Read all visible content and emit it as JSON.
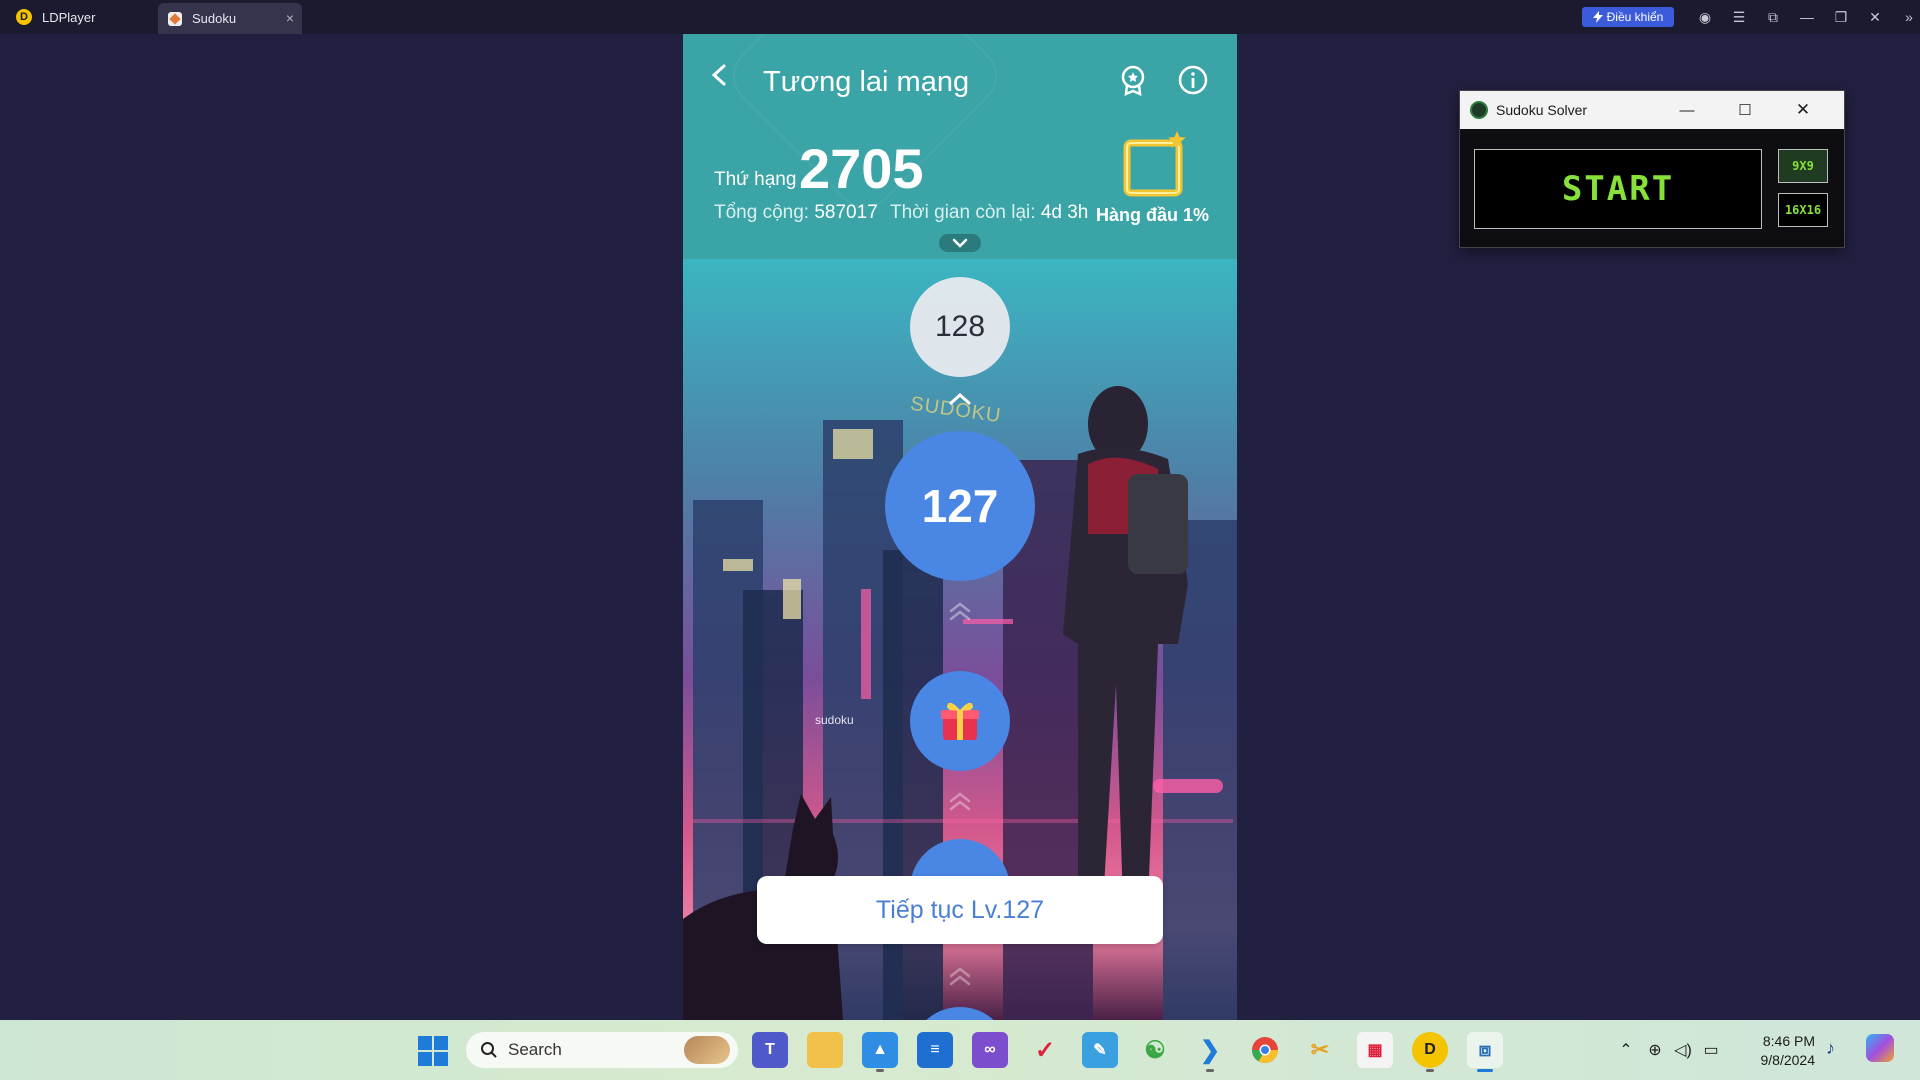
{
  "emulator": {
    "app_name": "LDPlayer",
    "tab_label": "Sudoku",
    "tab_close": "×",
    "control_label": "Điều khiển"
  },
  "game": {
    "title": "Tương lai mạng",
    "rank_label": "Thứ hạng",
    "rank_value": "2705",
    "total_label": "Tổng cộng:",
    "total_value": "587017",
    "time_label": "Thời gian còn lại:",
    "time_value": "4d 3h",
    "top_percent": "Hàng đầu 1%",
    "levels": {
      "upcoming": "128",
      "current": "127"
    },
    "sign_text": "SUDOKU",
    "small_sign": "sudoku",
    "continue_label": "Tiếp tục Lv.127"
  },
  "solver": {
    "title": "Sudoku Solver",
    "start_label": "START",
    "size_options": [
      "9X9",
      "16X16"
    ]
  },
  "taskbar": {
    "search_placeholder": "Search",
    "time": "8:46 PM",
    "date": "9/8/2024"
  },
  "colors": {
    "header_teal": "#3aa4a6",
    "level_blue": "#4a86e4",
    "solver_green": "#88e03a",
    "desktop_bg": "#222041"
  }
}
